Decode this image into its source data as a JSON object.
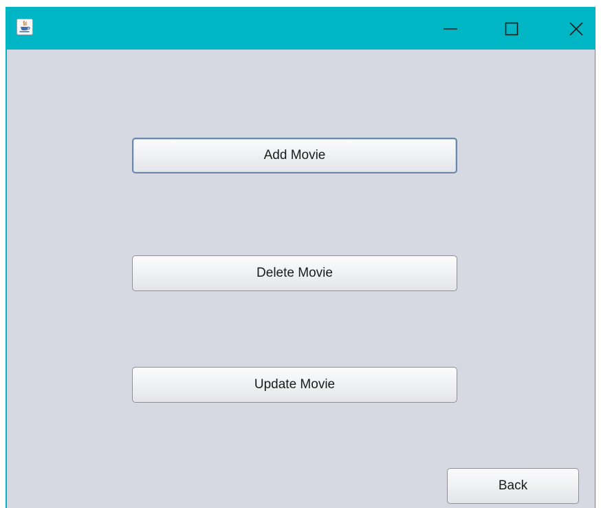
{
  "window": {
    "app_icon": "java-cup-icon",
    "controls": {
      "minimize_icon": "minimize-icon",
      "maximize_icon": "maximize-icon",
      "close_icon": "close-icon"
    }
  },
  "buttons": {
    "add_movie": "Add Movie",
    "delete_movie": "Delete Movie",
    "update_movie": "Update Movie",
    "back": "Back"
  },
  "colors": {
    "titlebar": "#00b6c4",
    "background": "#d6d9e1",
    "focus_border": "#6a86a8"
  }
}
